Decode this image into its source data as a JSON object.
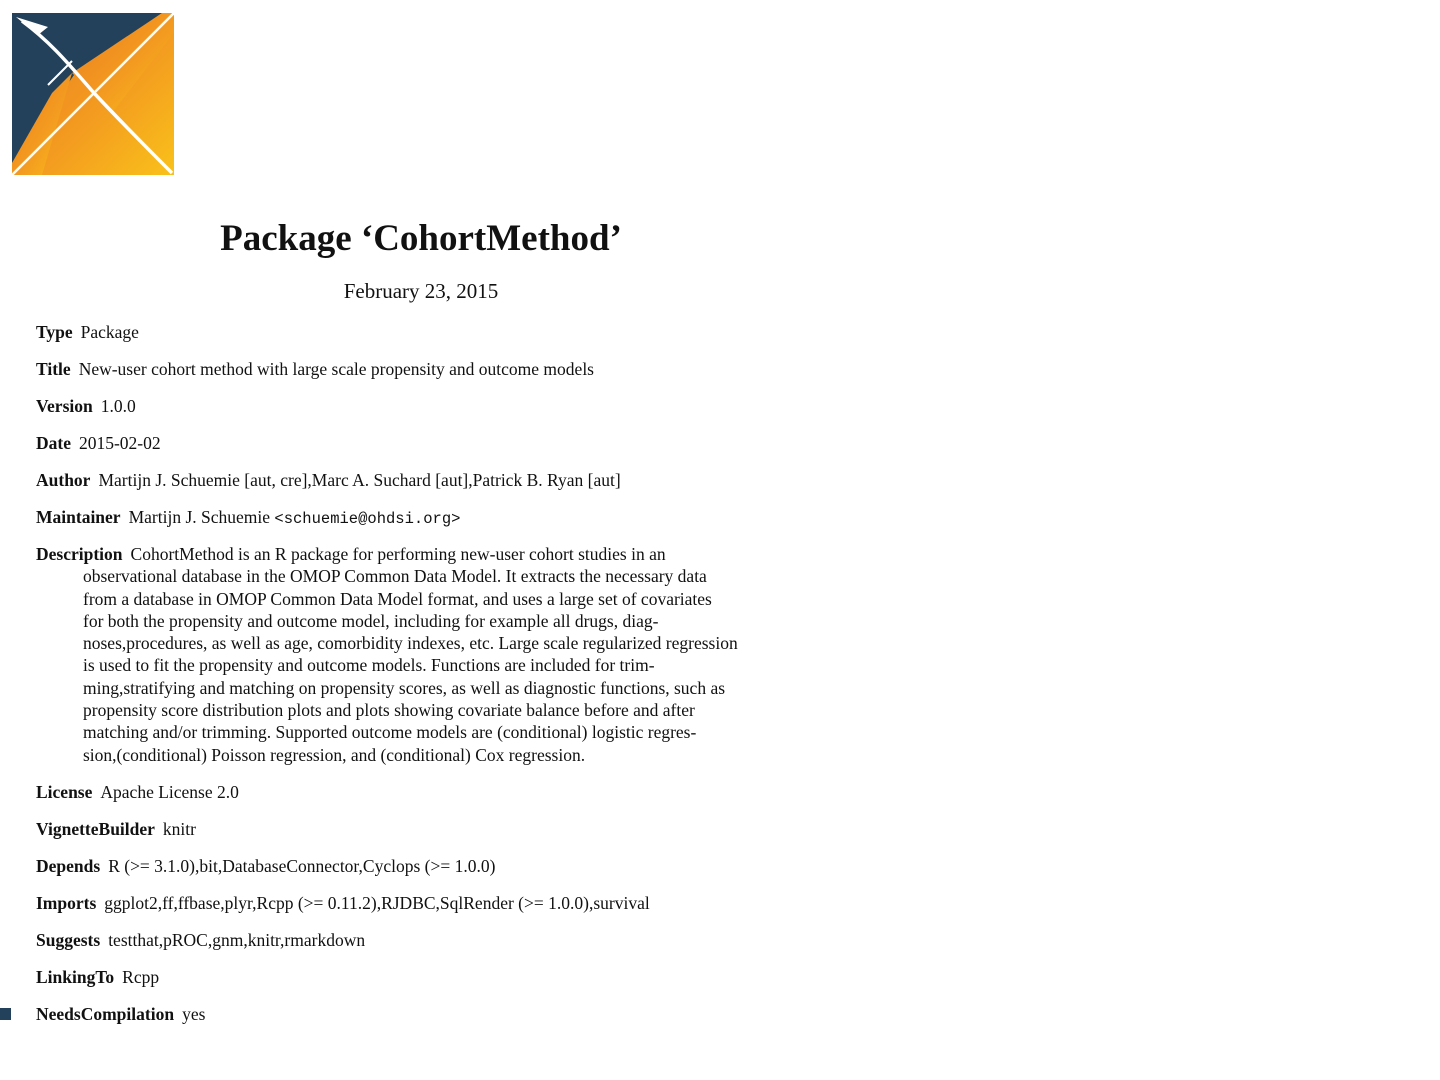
{
  "document": {
    "title": "Package ‘CohortMethod’",
    "date": "February 23, 2015",
    "fields": {
      "type": {
        "key": "Type",
        "value": "Package"
      },
      "title": {
        "key": "Title",
        "value": "New-user cohort method with large scale propensity and outcome models"
      },
      "version": {
        "key": "Version",
        "value": "1.0.0"
      },
      "date": {
        "key": "Date",
        "value": "2015-02-02"
      },
      "author": {
        "key": "Author",
        "value": "Martijn J. Schuemie [aut, cre],Marc A. Suchard [aut],Patrick B. Ryan [aut]"
      },
      "maintainer": {
        "key": "Maintainer",
        "name": "Martijn J. Schuemie",
        "email": "<schuemie@ohdsi.org>"
      },
      "description": {
        "key": "Description",
        "lines": [
          "CohortMethod is an R package for performing new-user cohort studies in an",
          "observational database in the OMOP Common Data Model. It extracts the necessary data",
          "from a database in OMOP Common Data Model format, and uses a large set of covariates",
          "for both the propensity and outcome model, including for example all drugs, diag-",
          "noses,procedures, as well as age, comorbidity indexes, etc. Large scale regularized regression",
          "is used to fit the propensity and outcome models. Functions are included for trim-",
          "ming,stratifying and matching on propensity scores, as well as diagnostic functions, such as",
          "propensity score distribution plots and plots showing covariate balance before and after",
          "matching and/or trimming. Supported outcome models are (conditional) logistic regres-",
          "sion,(conditional) Poisson regression, and (conditional) Cox regression."
        ]
      },
      "license": {
        "key": "License",
        "value": "Apache License 2.0"
      },
      "vignettebuilder": {
        "key": "VignetteBuilder",
        "value": "knitr"
      },
      "depends": {
        "key": "Depends",
        "value": "R (>= 3.1.0),bit,DatabaseConnector,Cyclops (>= 1.0.0)"
      },
      "imports": {
        "key": "Imports",
        "value": "ggplot2,ff,ffbase,plyr,Rcpp (>= 0.11.2),RJDBC,SqlRender (>= 1.0.0),survival"
      },
      "suggests": {
        "key": "Suggests",
        "value": "testthat,pROC,gnm,knitr,rmarkdown"
      },
      "linkingto": {
        "key": "LinkingTo",
        "value": "Rcpp"
      },
      "needscompilation": {
        "key": "NeedsCompilation",
        "value": "yes"
      }
    }
  },
  "logo": {
    "icon": "ohdsi-logo",
    "colors": {
      "navy": "#23415a",
      "orange": "#f08a22",
      "yellow": "#f8bd1c"
    }
  },
  "corner_mark": {
    "color": "#23415a"
  }
}
